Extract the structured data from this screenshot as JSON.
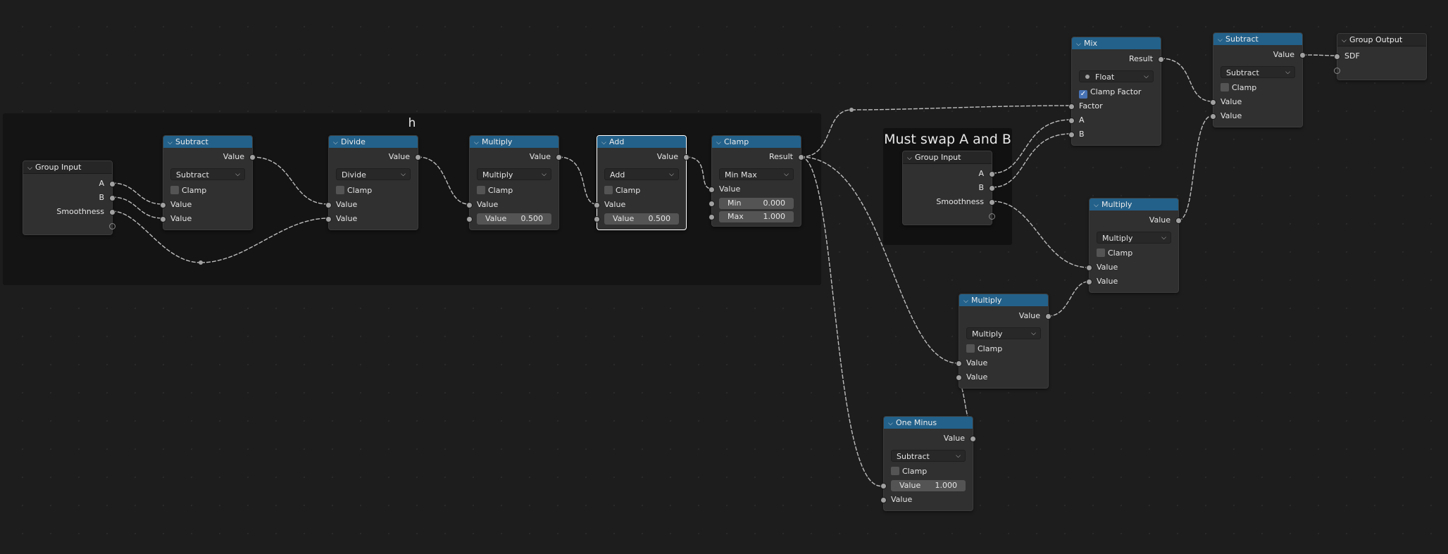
{
  "frames": {
    "h_label": "h",
    "swap_label": "Must swap A and B"
  },
  "colors": {
    "background": "#1d1d1d",
    "math_header": "#23618a",
    "group_header": "#262626",
    "node_body": "#303030",
    "socket_float": "#a1a1a1",
    "checkbox_on": "#4772b3",
    "link": "#bdbdbd"
  },
  "icons": {
    "collapse": "chevron-down-icon"
  },
  "nodes": {
    "group_input_1": {
      "title": "Group Input",
      "out_a": "A",
      "out_b": "B",
      "out_smooth": "Smoothness"
    },
    "subtract_1": {
      "title": "Subtract",
      "out": "Value",
      "op": "Subtract",
      "clamp": "Clamp",
      "in1": "Value",
      "in2": "Value"
    },
    "divide": {
      "title": "Divide",
      "out": "Value",
      "op": "Divide",
      "clamp": "Clamp",
      "in1": "Value",
      "in2": "Value"
    },
    "multiply_1": {
      "title": "Multiply",
      "out": "Value",
      "op": "Multiply",
      "clamp": "Clamp",
      "in1": "Value",
      "in2_label": "Value",
      "in2_value": "0.500"
    },
    "add": {
      "title": "Add",
      "out": "Value",
      "op": "Add",
      "clamp": "Clamp",
      "in1": "Value",
      "in2_label": "Value",
      "in2_value": "0.500"
    },
    "clamp": {
      "title": "Clamp",
      "out": "Result",
      "mode": "Min Max",
      "in_value": "Value",
      "min_label": "Min",
      "min_value": "0.000",
      "max_label": "Max",
      "max_value": "1.000"
    },
    "group_input_2": {
      "title": "Group Input",
      "out_a": "A",
      "out_b": "B",
      "out_smooth": "Smoothness"
    },
    "mix": {
      "title": "Mix",
      "out": "Result",
      "data_type": "Float",
      "clamp_factor": "Clamp Factor",
      "in_factor": "Factor",
      "in_a": "A",
      "in_b": "B"
    },
    "subtract_2": {
      "title": "Subtract",
      "out": "Value",
      "op": "Subtract",
      "clamp": "Clamp",
      "in1": "Value",
      "in2": "Value"
    },
    "group_output": {
      "title": "Group Output",
      "in_sdf": "SDF"
    },
    "multiply_2": {
      "title": "Multiply",
      "out": "Value",
      "op": "Multiply",
      "clamp": "Clamp",
      "in1": "Value",
      "in2": "Value"
    },
    "multiply_3": {
      "title": "Multiply",
      "out": "Value",
      "op": "Multiply",
      "clamp": "Clamp",
      "in1": "Value",
      "in2": "Value"
    },
    "one_minus": {
      "title": "One Minus",
      "out": "Value",
      "op": "Subtract",
      "clamp": "Clamp",
      "in1_label": "Value",
      "in1_value": "1.000",
      "in2": "Value"
    }
  }
}
